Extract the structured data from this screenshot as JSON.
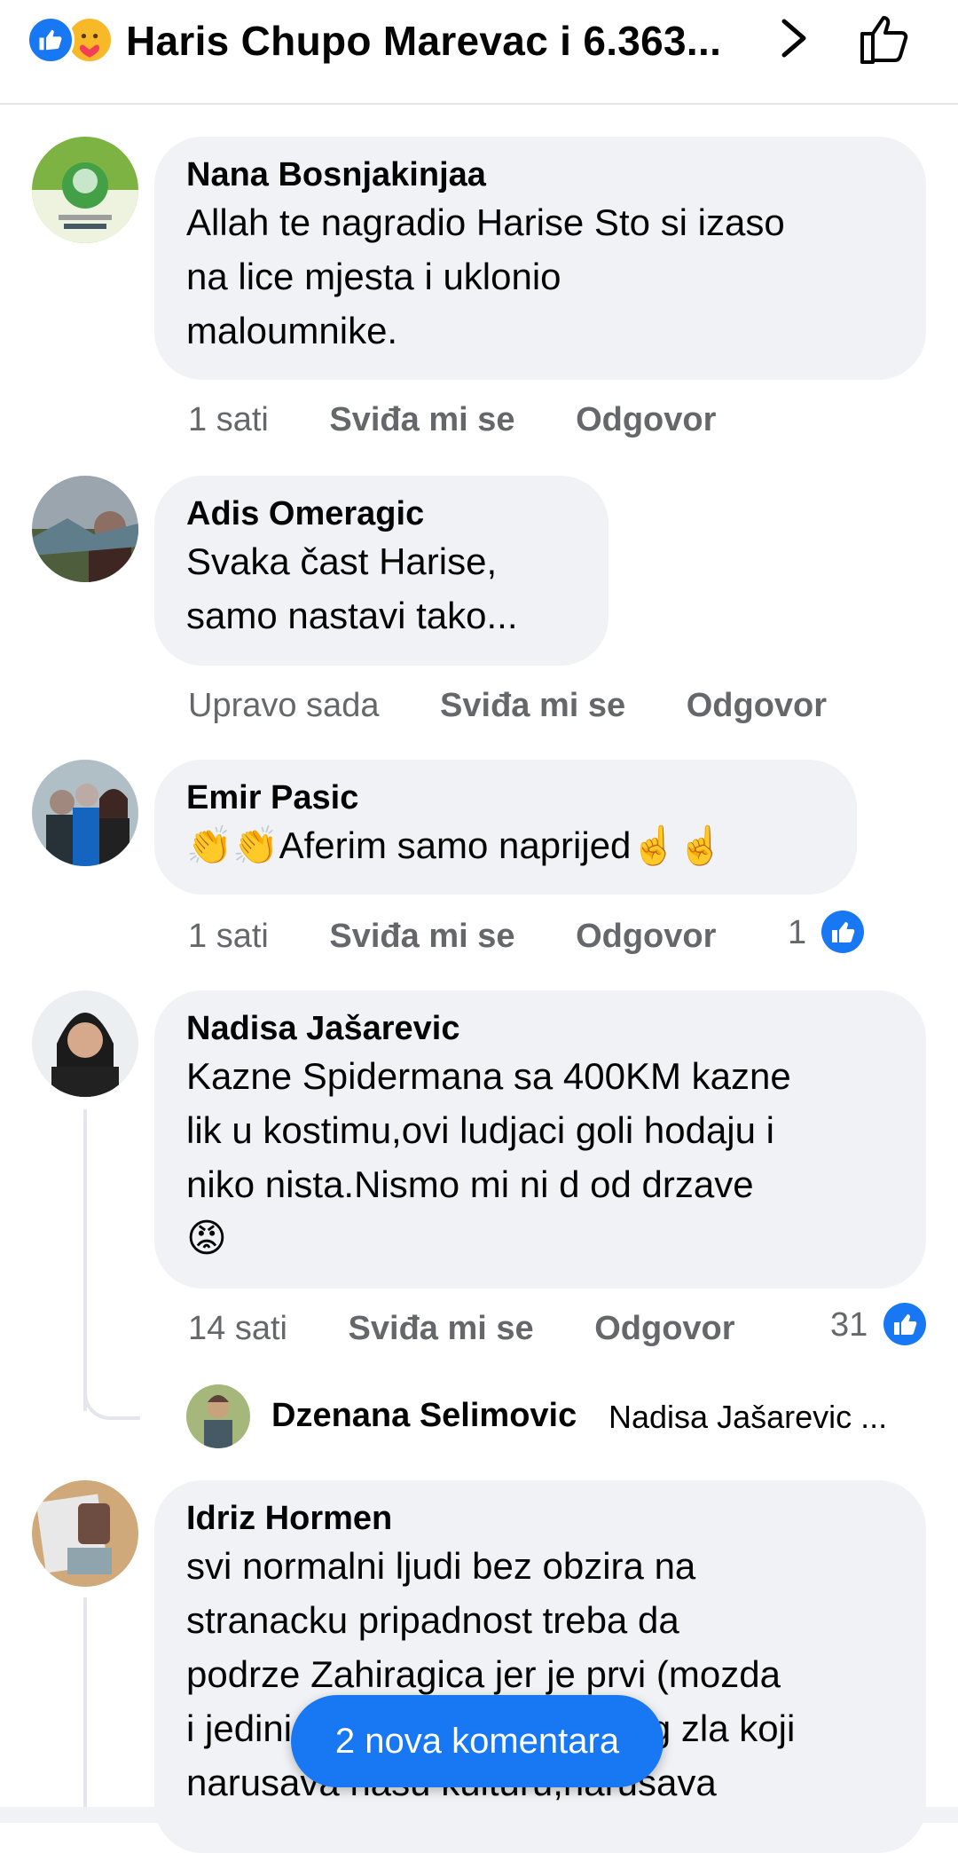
{
  "header": {
    "title": "Haris Chupo Marevac i 6.363...",
    "reaction_icons": [
      "like-reaction-icon",
      "care-reaction-icon"
    ],
    "chevron_icon": "chevron-right-icon",
    "like_icon": "thumbs-up-outline-icon"
  },
  "comments": [
    {
      "author": "Nana Bosnjakinjaa",
      "lines": [
        "Allah te nagradio Harise Sto si izaso",
        "na lice mjesta i uklonio",
        "maloumnike."
      ],
      "time": "1 sati",
      "like_label": "Sviđa mi se",
      "reply_label": "Odgovor"
    },
    {
      "author": "Adis Omeragic",
      "lines": [
        "Svaka čast Harise,",
        "samo nastavi tako..."
      ],
      "time": "Upravo sada",
      "like_label": "Sviđa mi se",
      "reply_label": "Odgovor"
    },
    {
      "author": "Emir Pasic",
      "lines": [
        "👏👏Aferim samo naprijed☝️☝️"
      ],
      "time": "1 sati",
      "like_label": "Sviđa mi se",
      "reply_label": "Odgovor",
      "likes": "1"
    },
    {
      "author": "Nadisa Jašarevic",
      "lines": [
        "Kazne Spidermana sa 400KM kazne",
        "lik u kostimu,ovi ludjaci goli hodaju i",
        "niko nista.Nismo mi ni d od drzave",
        "😡"
      ],
      "time": "14 sati",
      "like_label": "Sviđa mi se",
      "reply_label": "Odgovor",
      "likes": "31",
      "reply": {
        "author": "Dzenana Selimovic",
        "text": "Nadisa Jašarevic ..."
      }
    },
    {
      "author": "Idriz Hormen",
      "lines": [
        "svi normalni ljudi bez obzira na",
        "stranacku pripadnost treba da",
        "podrze Zahiragica jer je prvi (mozda",
        "i jedini koji se bori protiv svog zla koji",
        "narusava nasu kulturu,narusava"
      ]
    }
  ],
  "new_comments_button": "2 nova komentara",
  "colors": {
    "accent": "#1877f2",
    "bubble": "#f0f2f5",
    "meta_text": "#65676b"
  }
}
